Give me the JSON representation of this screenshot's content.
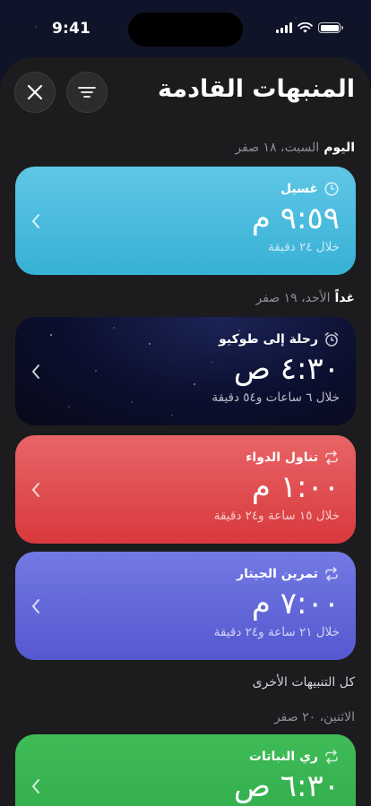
{
  "status": {
    "time": "9:41"
  },
  "header": {
    "title": "المنبهات القادمة"
  },
  "sections": {
    "today": {
      "label": "اليوم",
      "date": "السبت، ١٨ صفر"
    },
    "tomorrow": {
      "label": "غداً",
      "date": "الأحد، ١٩ صفر"
    },
    "others_title": "كل التنبيهات الأخرى",
    "monday": {
      "date": "الاثنين، ٢٠ صفر"
    }
  },
  "alarms": [
    {
      "name": "غسيل",
      "time": "٩:٥٩ م",
      "until": "خلال ٢٤ دقيقة",
      "icon": "clock-icon",
      "color": "#4bbde0"
    },
    {
      "name": "رحلة إلى طوكيو",
      "time": "٤:٣٠ ص",
      "until": "خلال ٦ ساعات و٥٤ دقيقة",
      "icon": "alarm-clock-icon",
      "color": "#0b0f2e"
    },
    {
      "name": "تناول الدواء",
      "time": "١:٠٠ م",
      "until": "خلال ١٥ ساعة و٢٤ دقيقة",
      "icon": "repeat-icon",
      "color": "#e04a4d"
    },
    {
      "name": "تمرين الجيتار",
      "time": "٧:٠٠ م",
      "until": "خلال ٢١ ساعة و٢٤ دقيقة",
      "icon": "repeat-icon",
      "color": "#6468da"
    },
    {
      "name": "ري النباتات",
      "time": "٦:٣٠ ص",
      "until": "",
      "icon": "repeat-icon",
      "color": "#36b351"
    }
  ]
}
